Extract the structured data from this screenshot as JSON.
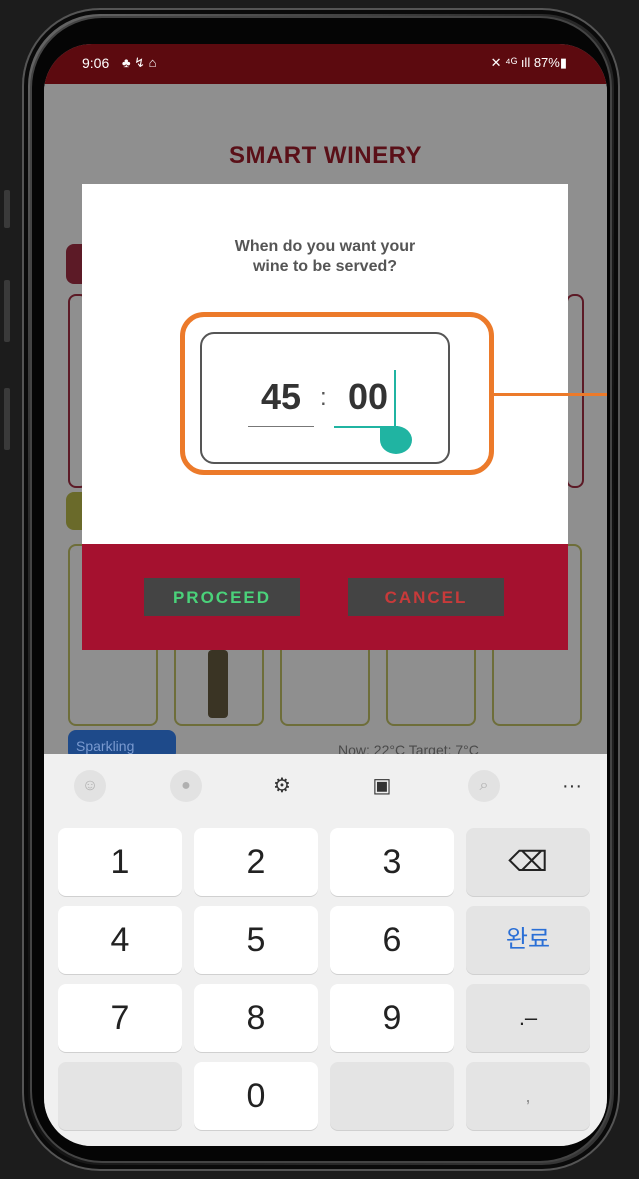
{
  "status_bar": {
    "time": "9:06",
    "left_icons": "♣ ↯ ⌂",
    "right": "✕ ⁴ᴳ ıll 87%▮"
  },
  "app": {
    "title": "SMART WINERY",
    "bg_label_sparkling": "Sparkling",
    "bg_now_target": "Now: 22°C   Target: 7°C"
  },
  "dialog": {
    "question_line1": "When do you want your",
    "question_line2": "wine to be served?",
    "hours": "45",
    "separator": ":",
    "minutes": "00",
    "proceed_label": "PROCEED",
    "cancel_label": "CANCEL",
    "accent_color": "#ec7a2a",
    "cursor_color": "#20b4a2"
  },
  "keyboard": {
    "toolbar": [
      "emoji-icon",
      "mic-icon",
      "settings-icon",
      "clipboard-icon",
      "search-icon",
      "more-icon"
    ],
    "toolbar_more": "···",
    "keys": {
      "k1": "1",
      "k2": "2",
      "k3": "3",
      "backspace": "⌫",
      "k4": "4",
      "k5": "5",
      "k6": "6",
      "done": "완료",
      "k7": "7",
      "k8": "8",
      "k9": "9",
      "punct": ".–",
      "k0": "0",
      "comma": ","
    }
  }
}
